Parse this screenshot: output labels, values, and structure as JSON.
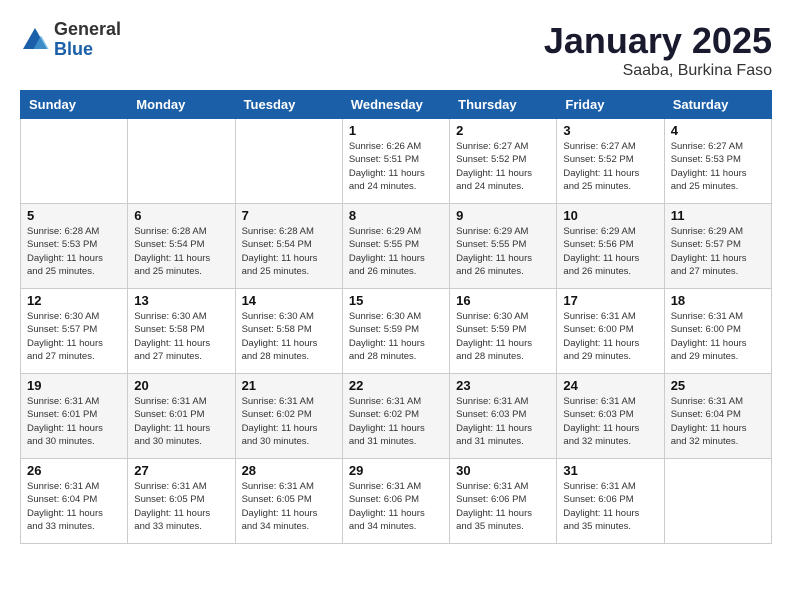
{
  "header": {
    "logo_general": "General",
    "logo_blue": "Blue",
    "title": "January 2025",
    "subtitle": "Saaba, Burkina Faso"
  },
  "weekdays": [
    "Sunday",
    "Monday",
    "Tuesday",
    "Wednesday",
    "Thursday",
    "Friday",
    "Saturday"
  ],
  "weeks": [
    [
      {
        "day": "",
        "info": ""
      },
      {
        "day": "",
        "info": ""
      },
      {
        "day": "",
        "info": ""
      },
      {
        "day": "1",
        "info": "Sunrise: 6:26 AM\nSunset: 5:51 PM\nDaylight: 11 hours\nand 24 minutes."
      },
      {
        "day": "2",
        "info": "Sunrise: 6:27 AM\nSunset: 5:52 PM\nDaylight: 11 hours\nand 24 minutes."
      },
      {
        "day": "3",
        "info": "Sunrise: 6:27 AM\nSunset: 5:52 PM\nDaylight: 11 hours\nand 25 minutes."
      },
      {
        "day": "4",
        "info": "Sunrise: 6:27 AM\nSunset: 5:53 PM\nDaylight: 11 hours\nand 25 minutes."
      }
    ],
    [
      {
        "day": "5",
        "info": "Sunrise: 6:28 AM\nSunset: 5:53 PM\nDaylight: 11 hours\nand 25 minutes."
      },
      {
        "day": "6",
        "info": "Sunrise: 6:28 AM\nSunset: 5:54 PM\nDaylight: 11 hours\nand 25 minutes."
      },
      {
        "day": "7",
        "info": "Sunrise: 6:28 AM\nSunset: 5:54 PM\nDaylight: 11 hours\nand 25 minutes."
      },
      {
        "day": "8",
        "info": "Sunrise: 6:29 AM\nSunset: 5:55 PM\nDaylight: 11 hours\nand 26 minutes."
      },
      {
        "day": "9",
        "info": "Sunrise: 6:29 AM\nSunset: 5:55 PM\nDaylight: 11 hours\nand 26 minutes."
      },
      {
        "day": "10",
        "info": "Sunrise: 6:29 AM\nSunset: 5:56 PM\nDaylight: 11 hours\nand 26 minutes."
      },
      {
        "day": "11",
        "info": "Sunrise: 6:29 AM\nSunset: 5:57 PM\nDaylight: 11 hours\nand 27 minutes."
      }
    ],
    [
      {
        "day": "12",
        "info": "Sunrise: 6:30 AM\nSunset: 5:57 PM\nDaylight: 11 hours\nand 27 minutes."
      },
      {
        "day": "13",
        "info": "Sunrise: 6:30 AM\nSunset: 5:58 PM\nDaylight: 11 hours\nand 27 minutes."
      },
      {
        "day": "14",
        "info": "Sunrise: 6:30 AM\nSunset: 5:58 PM\nDaylight: 11 hours\nand 28 minutes."
      },
      {
        "day": "15",
        "info": "Sunrise: 6:30 AM\nSunset: 5:59 PM\nDaylight: 11 hours\nand 28 minutes."
      },
      {
        "day": "16",
        "info": "Sunrise: 6:30 AM\nSunset: 5:59 PM\nDaylight: 11 hours\nand 28 minutes."
      },
      {
        "day": "17",
        "info": "Sunrise: 6:31 AM\nSunset: 6:00 PM\nDaylight: 11 hours\nand 29 minutes."
      },
      {
        "day": "18",
        "info": "Sunrise: 6:31 AM\nSunset: 6:00 PM\nDaylight: 11 hours\nand 29 minutes."
      }
    ],
    [
      {
        "day": "19",
        "info": "Sunrise: 6:31 AM\nSunset: 6:01 PM\nDaylight: 11 hours\nand 30 minutes."
      },
      {
        "day": "20",
        "info": "Sunrise: 6:31 AM\nSunset: 6:01 PM\nDaylight: 11 hours\nand 30 minutes."
      },
      {
        "day": "21",
        "info": "Sunrise: 6:31 AM\nSunset: 6:02 PM\nDaylight: 11 hours\nand 30 minutes."
      },
      {
        "day": "22",
        "info": "Sunrise: 6:31 AM\nSunset: 6:02 PM\nDaylight: 11 hours\nand 31 minutes."
      },
      {
        "day": "23",
        "info": "Sunrise: 6:31 AM\nSunset: 6:03 PM\nDaylight: 11 hours\nand 31 minutes."
      },
      {
        "day": "24",
        "info": "Sunrise: 6:31 AM\nSunset: 6:03 PM\nDaylight: 11 hours\nand 32 minutes."
      },
      {
        "day": "25",
        "info": "Sunrise: 6:31 AM\nSunset: 6:04 PM\nDaylight: 11 hours\nand 32 minutes."
      }
    ],
    [
      {
        "day": "26",
        "info": "Sunrise: 6:31 AM\nSunset: 6:04 PM\nDaylight: 11 hours\nand 33 minutes."
      },
      {
        "day": "27",
        "info": "Sunrise: 6:31 AM\nSunset: 6:05 PM\nDaylight: 11 hours\nand 33 minutes."
      },
      {
        "day": "28",
        "info": "Sunrise: 6:31 AM\nSunset: 6:05 PM\nDaylight: 11 hours\nand 34 minutes."
      },
      {
        "day": "29",
        "info": "Sunrise: 6:31 AM\nSunset: 6:06 PM\nDaylight: 11 hours\nand 34 minutes."
      },
      {
        "day": "30",
        "info": "Sunrise: 6:31 AM\nSunset: 6:06 PM\nDaylight: 11 hours\nand 35 minutes."
      },
      {
        "day": "31",
        "info": "Sunrise: 6:31 AM\nSunset: 6:06 PM\nDaylight: 11 hours\nand 35 minutes."
      },
      {
        "day": "",
        "info": ""
      }
    ]
  ]
}
